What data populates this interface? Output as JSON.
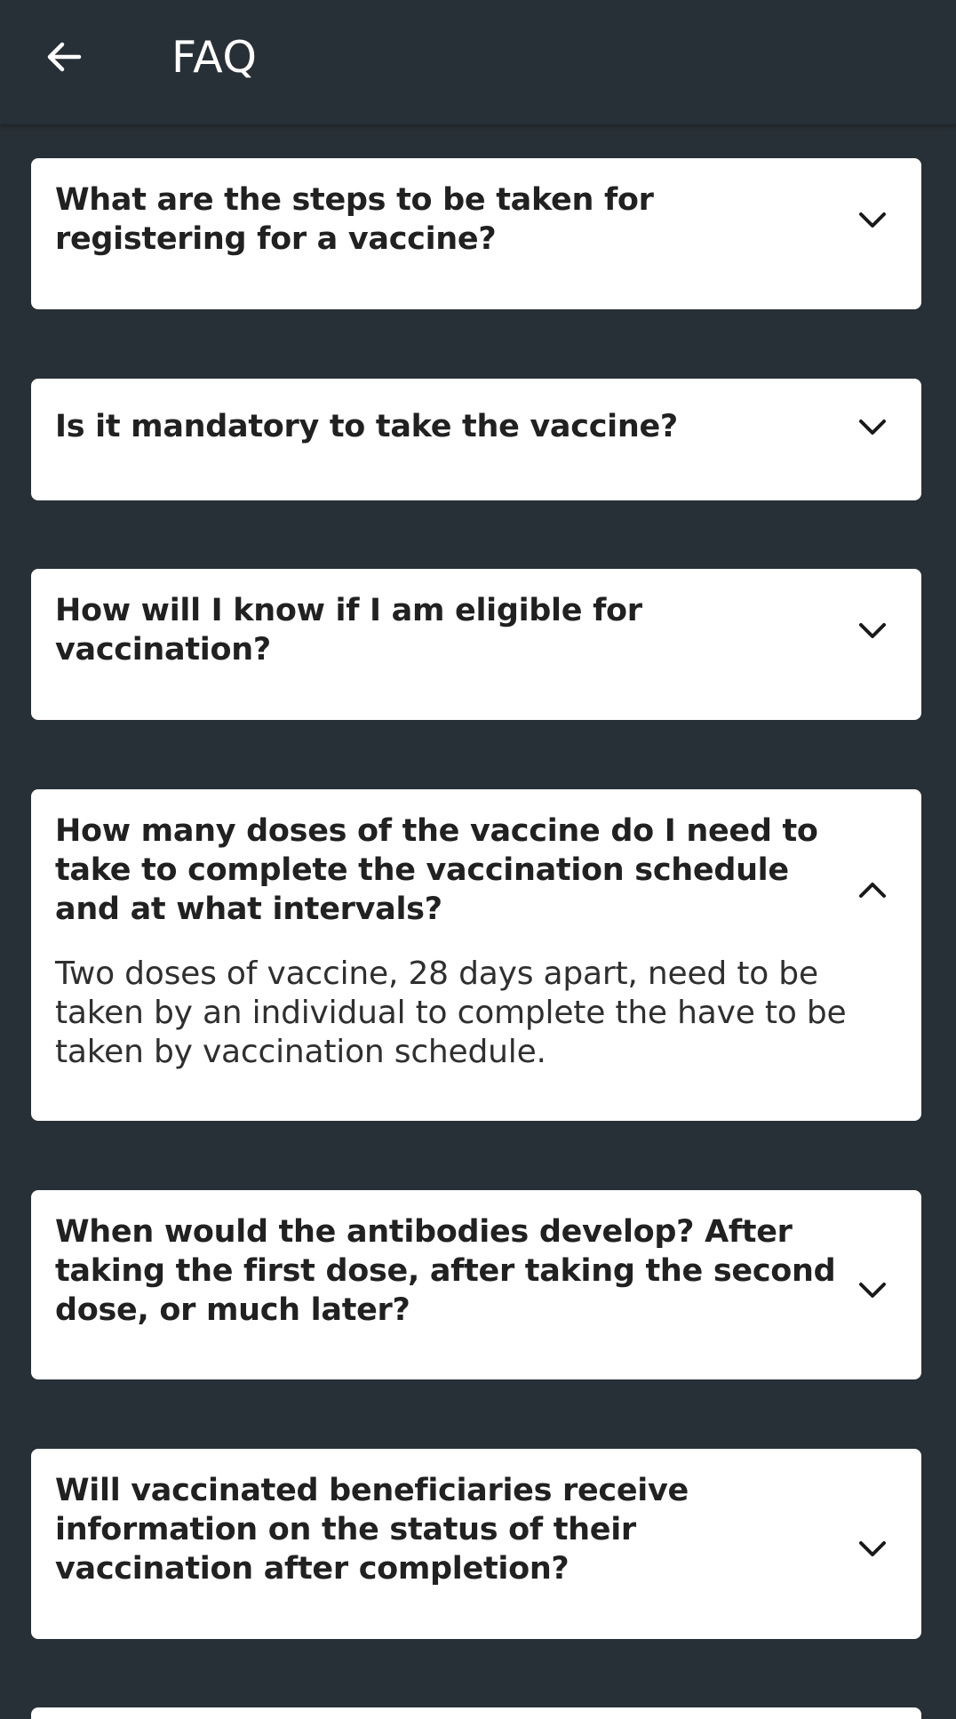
{
  "app_bar": {
    "title": "FAQ",
    "back_icon": "arrow-left-icon"
  },
  "colors": {
    "background": "#283037",
    "card": "#ffffff",
    "text": "#212121"
  },
  "faqs": [
    {
      "question": "What are the steps to be taken for registering for a vaccine?",
      "expanded": false,
      "icon": "chevron-down-icon"
    },
    {
      "question": "Is it mandatory to take the vaccine?",
      "expanded": false,
      "icon": "chevron-down-icon"
    },
    {
      "question": "How will I know if I am eligible for vaccination?",
      "expanded": false,
      "icon": "chevron-down-icon"
    },
    {
      "question": "How many doses of the vaccine do I need to take to complete the vaccination schedule and at what intervals?",
      "answer": "Two doses of vaccine, 28 days apart, need to be taken by an individual to complete the have to be taken by vaccination schedule.",
      "expanded": true,
      "icon": "chevron-up-icon"
    },
    {
      "question": "When would the antibodies develop? After taking the first dose, after taking the second dose, or much later?",
      "expanded": false,
      "icon": "chevron-down-icon"
    },
    {
      "question": "Will vaccinated beneficiaries receive information on the status of their vaccination after completion?",
      "expanded": false,
      "icon": "chevron-down-icon"
    }
  ]
}
